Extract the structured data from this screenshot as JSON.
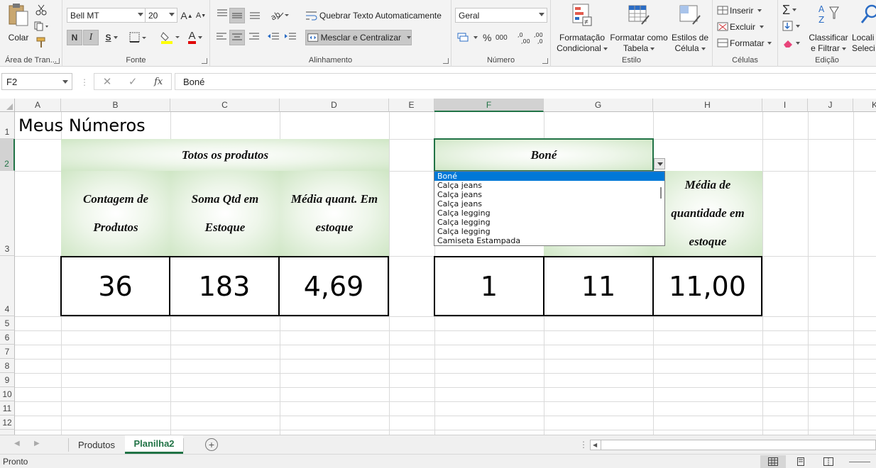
{
  "ribbon": {
    "clipboard": {
      "paste_label": "Colar",
      "group_label": "Área de Tran..."
    },
    "font": {
      "font_name": "Bell MT",
      "font_size": "20",
      "bold": "N",
      "italic": "I",
      "underline": "S",
      "group_label": "Fonte",
      "grow": "A",
      "shrink": "A",
      "font_color_letter": "A"
    },
    "alignment": {
      "wrap_text": "Quebrar Texto Automaticamente",
      "merge_center": "Mesclar e Centralizar",
      "group_label": "Alinhamento"
    },
    "number": {
      "format": "Geral",
      "currency": "$",
      "percent": "%",
      "thousands": "000",
      "group_label": "Número"
    },
    "styles": {
      "conditional_line1": "Formatação",
      "conditional_line2": "Condicional",
      "table_line1": "Formatar como",
      "table_line2": "Tabela",
      "cell_styles_line1": "Estilos de",
      "cell_styles_line2": "Célula",
      "group_label": "Estilo"
    },
    "cells": {
      "insert": "Inserir",
      "delete": "Excluir",
      "format": "Formatar",
      "group_label": "Células"
    },
    "editing": {
      "sort_line1": "Classificar",
      "sort_line2": "e Filtrar",
      "find_line1": "Locali",
      "find_line2": "Seleci",
      "group_label": "Edição"
    }
  },
  "formula_bar": {
    "name_box": "F2",
    "cancel": "✕",
    "enter": "✓",
    "fx": "fx",
    "content": "Boné"
  },
  "columns": [
    "A",
    "B",
    "C",
    "D",
    "E",
    "F",
    "G",
    "H",
    "I",
    "J",
    "K"
  ],
  "rows": [
    "1",
    "2",
    "3",
    "4",
    "5",
    "6",
    "7",
    "8",
    "9",
    "10",
    "11",
    "12"
  ],
  "sheet": {
    "title": "Meus Números",
    "left_block": {
      "header": "Totos os produtos",
      "col1_line1": "Contagem de",
      "col1_line2": "Produtos",
      "col2_line1": "Soma Qtd em",
      "col2_line2": "Estoque",
      "col3_line1": "Média quant. Em",
      "col3_line2": "estoque",
      "values": [
        "36",
        "183",
        "4,69"
      ]
    },
    "right_block": {
      "header": "Boné",
      "col3_line1": "Média de",
      "col3_line2": "quantidade em",
      "col3_line3": "estoque",
      "values": [
        "1",
        "11",
        "11,00"
      ]
    }
  },
  "dropdown": {
    "items": [
      "Boné",
      "Calça jeans",
      "Calça jeans",
      "Calça jeans",
      "Calça legging",
      "Calça legging",
      "Calça legging",
      "Camiseta Estampada"
    ]
  },
  "tabs": {
    "items": [
      "Produtos",
      "Planilha2"
    ],
    "add": "+"
  },
  "status": {
    "text": "Pronto"
  },
  "colors": {
    "accent": "#217346",
    "selection_blue": "#0078d7"
  }
}
